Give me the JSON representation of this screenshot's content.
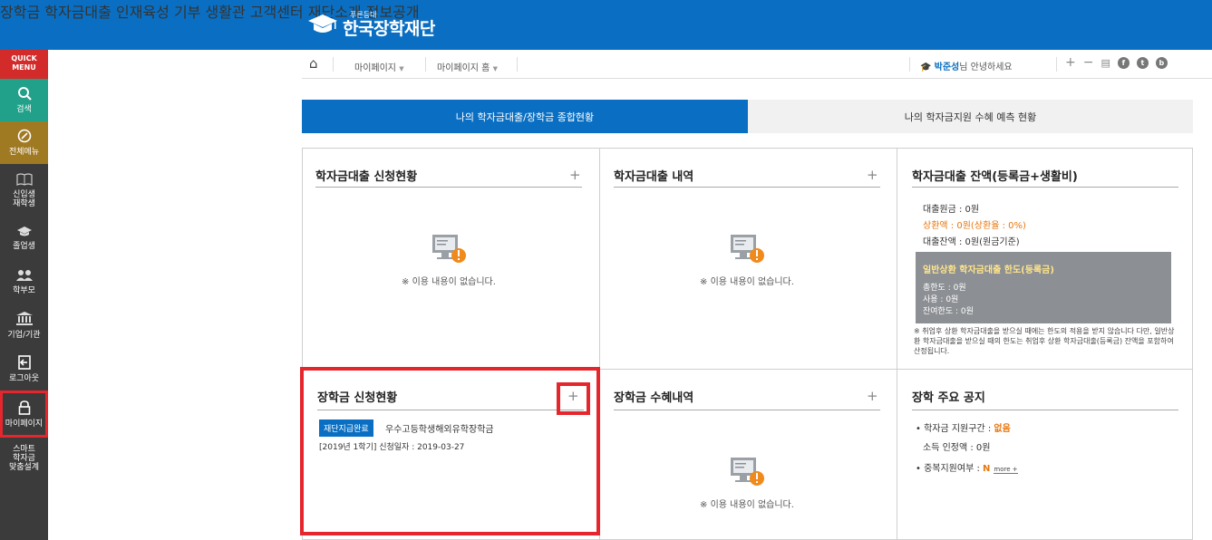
{
  "header": {
    "logo_small": "푸른등대",
    "logo_title": "한국장학재단",
    "nav": [
      "장학금",
      "학자금대출",
      "인재육성",
      "기부",
      "생활관",
      "고객센터",
      "재단소개",
      "정보공개"
    ]
  },
  "quick_menu": {
    "title_line1": "QUICK",
    "title_line2": "MENU",
    "items": [
      {
        "label": "검색",
        "icon": "search-icon"
      },
      {
        "label": "전체메뉴",
        "icon": "compass-icon"
      },
      {
        "label_line1": "신입생",
        "label_line2": "재학생",
        "icon": "book-icon"
      },
      {
        "label": "졸업생",
        "icon": "graduation-cap-icon"
      },
      {
        "label": "학부모",
        "icon": "people-icon"
      },
      {
        "label": "기업/기관",
        "icon": "bank-icon"
      },
      {
        "label": "로그아웃",
        "icon": "logout-icon"
      },
      {
        "label": "마이페이지",
        "icon": "lock-icon"
      },
      {
        "label_line1": "스마트",
        "label_line2": "학자금",
        "label_line3": "맞춤설계",
        "icon": "none"
      }
    ]
  },
  "breadcrumb": {
    "level1": "마이페이지",
    "level2": "마이페이지 홈",
    "user_name": "박준성",
    "user_greeting": "님 안녕하세요"
  },
  "tabs": {
    "active": "나의 학자금대출/장학금 종합현황",
    "inactive": "나의 학자금지원 수혜 예측 현황"
  },
  "panels": {
    "loan_apply": {
      "title": "학자금대출 신청현황",
      "empty": "※ 이용 내용이 없습니다."
    },
    "loan_history": {
      "title": "학자금대출 내역",
      "empty": "※ 이용 내용이 없습니다."
    },
    "loan_balance": {
      "title": "학자금대출 잔액(등록금+생활비)",
      "principal": "대출원금 : 0원",
      "repaid": "상환액 : 0원(상환율 : 0%)",
      "balance": "대출잔액 : 0원(원금기준)",
      "limit_title": "일반상환 학자금대출 한도(등록금)",
      "limit_total": "총한도 : 0원",
      "limit_used": "사용 : 0원",
      "limit_remaining": "잔여한도 : 0원",
      "note": "※ 취업후 상환 학자금대출을 받으실 때에는 한도의 적용을 받지 않습니다 다만, 일반상환 학자금대출을 받으실 때의 한도는 취업후 상환 학자금대출(등록금) 잔액을 포함하여 산정됩니다."
    },
    "scholarship_apply": {
      "title": "장학금 신청현황",
      "badge": "재단지급완료",
      "name": "우수고등학생해외유학장학금",
      "detail": "[2019년 1학기]  신청일자 : 2019-03-27"
    },
    "scholarship_history": {
      "title": "장학금 수혜내역",
      "empty": "※ 이용 내용이 없습니다."
    },
    "notice": {
      "title": "장학 주요 공지",
      "bracket_label": "• 학자금 지원구간 : ",
      "bracket_value": "없음",
      "income": "소득 인정액 : 0원",
      "dup_label": "• 중복지원여부 : ",
      "dup_value": "N",
      "more": "more +"
    }
  },
  "colors": {
    "brand": "#0a6fc2",
    "highlight": "#e5262d",
    "orange": "#e8760e"
  }
}
